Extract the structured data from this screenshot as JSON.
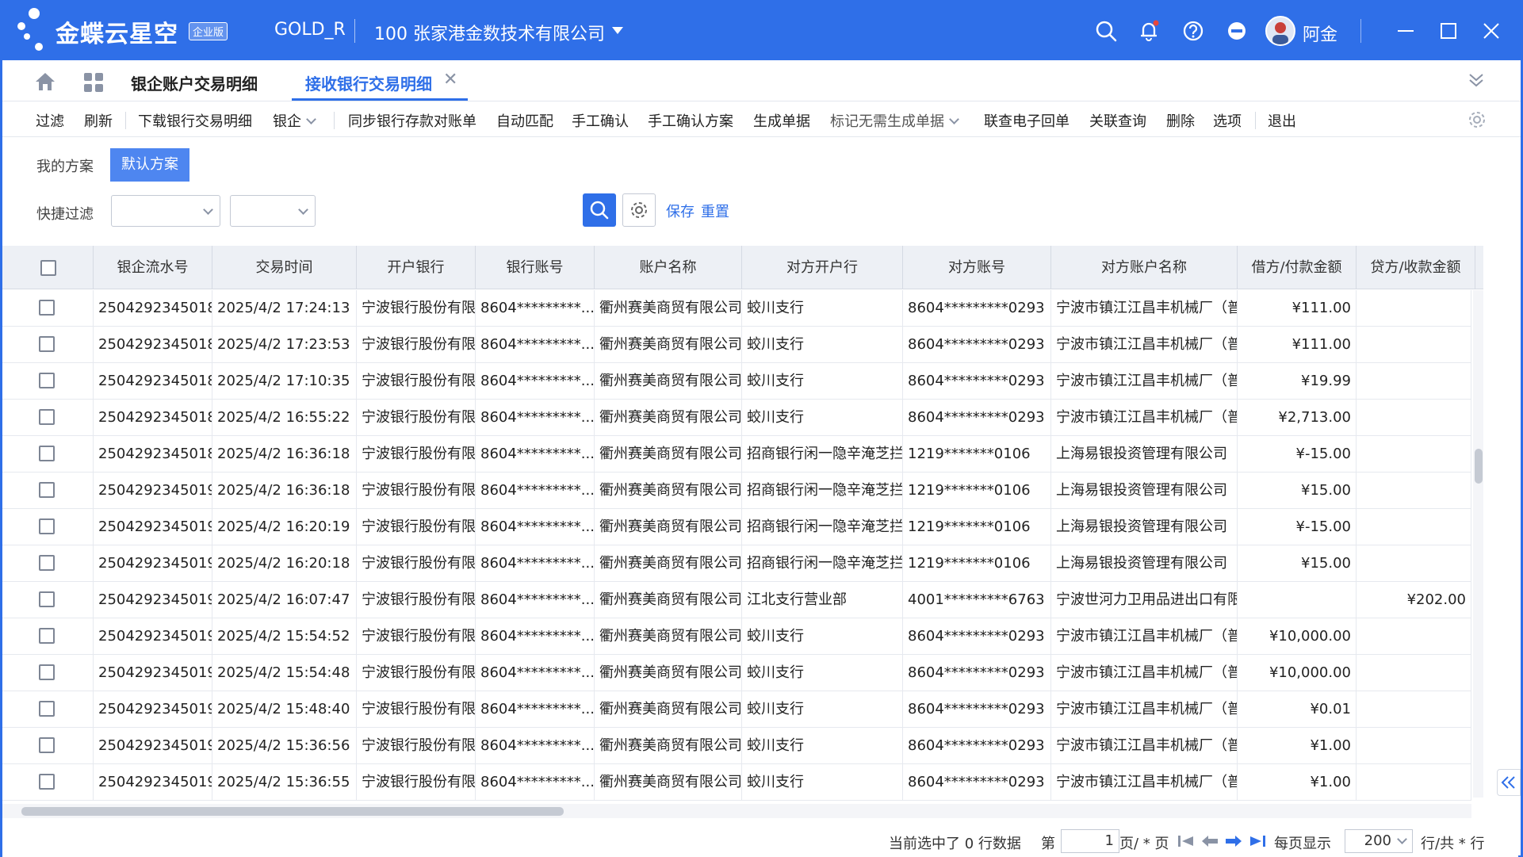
{
  "app": {
    "brand": "金蝶云星空",
    "edition": "企业版",
    "tenant": "GOLD_R",
    "org": "100  张家港金数技术有限公司",
    "user": "阿金"
  },
  "tabs": [
    {
      "label": "银企账户交易明细"
    },
    {
      "label": "接收银行交易明细"
    }
  ],
  "toolbar": {
    "filter": "过滤",
    "refresh": "刷新",
    "download": "下载银行交易明细",
    "yinqi": "银企",
    "sync": "同步银行存款对账单",
    "auto_match": "自动匹配",
    "manual_confirm": "手工确认",
    "manual_plan": "手工确认方案",
    "gen_doc": "生成单据",
    "mark_no_doc": "标记无需生成单据",
    "e_receipt": "联查电子回单",
    "rel_query": "关联查询",
    "delete": "删除",
    "options": "选项",
    "exit": "退出"
  },
  "filter": {
    "my_scheme": "我的方案",
    "default_scheme": "默认方案",
    "quick_filter": "快捷过滤",
    "save": "保存",
    "reset": "重置"
  },
  "grid": {
    "columns": [
      "银企流水号",
      "交易时间",
      "开户银行",
      "银行账号",
      "账户名称",
      "对方开户行",
      "对方账号",
      "对方账户名称",
      "借方/付款金额",
      "贷方/收款金额"
    ],
    "rows": [
      [
        "2504292345018",
        "2025/4/2 17:24:13",
        "宁波银行股份有限",
        "8604*********...",
        "衢州赛美商贸有限公司",
        "蛟川支行",
        "8604*********0293",
        "宁波市镇江江昌丰机械厂（普",
        "¥111.00",
        ""
      ],
      [
        "2504292345018",
        "2025/4/2 17:23:53",
        "宁波银行股份有限",
        "8604*********...",
        "衢州赛美商贸有限公司",
        "蛟川支行",
        "8604*********0293",
        "宁波市镇江江昌丰机械厂（普",
        "¥111.00",
        ""
      ],
      [
        "2504292345018",
        "2025/4/2 17:10:35",
        "宁波银行股份有限",
        "8604*********...",
        "衢州赛美商贸有限公司",
        "蛟川支行",
        "8604*********0293",
        "宁波市镇江江昌丰机械厂（普",
        "¥19.99",
        ""
      ],
      [
        "2504292345018",
        "2025/4/2 16:55:22",
        "宁波银行股份有限",
        "8604*********...",
        "衢州赛美商贸有限公司",
        "蛟川支行",
        "8604*********0293",
        "宁波市镇江江昌丰机械厂（普",
        "¥2,713.00",
        ""
      ],
      [
        "2504292345018",
        "2025/4/2 16:36:18",
        "宁波银行股份有限",
        "8604*********...",
        "衢州赛美商贸有限公司",
        "招商银行闲一隐辛淹芝拦",
        "1219*******0106",
        "上海易银投资管理有限公司",
        "¥-15.00",
        ""
      ],
      [
        "2504292345019",
        "2025/4/2 16:36:18",
        "宁波银行股份有限",
        "8604*********...",
        "衢州赛美商贸有限公司",
        "招商银行闲一隐辛淹芝拦",
        "1219*******0106",
        "上海易银投资管理有限公司",
        "¥15.00",
        ""
      ],
      [
        "2504292345019",
        "2025/4/2 16:20:19",
        "宁波银行股份有限",
        "8604*********...",
        "衢州赛美商贸有限公司",
        "招商银行闲一隐辛淹芝拦",
        "1219*******0106",
        "上海易银投资管理有限公司",
        "¥-15.00",
        ""
      ],
      [
        "2504292345019",
        "2025/4/2 16:20:18",
        "宁波银行股份有限",
        "8604*********...",
        "衢州赛美商贸有限公司",
        "招商银行闲一隐辛淹芝拦",
        "1219*******0106",
        "上海易银投资管理有限公司",
        "¥15.00",
        ""
      ],
      [
        "2504292345019",
        "2025/4/2 16:07:47",
        "宁波银行股份有限",
        "8604*********...",
        "衢州赛美商贸有限公司",
        "江北支行营业部",
        "4001*********6763",
        "宁波世河力卫用品进出口有限",
        "",
        "¥202.00"
      ],
      [
        "2504292345019",
        "2025/4/2 15:54:52",
        "宁波银行股份有限",
        "8604*********...",
        "衢州赛美商贸有限公司",
        "蛟川支行",
        "8604*********0293",
        "宁波市镇江江昌丰机械厂（普",
        "¥10,000.00",
        ""
      ],
      [
        "2504292345019",
        "2025/4/2 15:54:48",
        "宁波银行股份有限",
        "8604*********...",
        "衢州赛美商贸有限公司",
        "蛟川支行",
        "8604*********0293",
        "宁波市镇江江昌丰机械厂（普",
        "¥10,000.00",
        ""
      ],
      [
        "2504292345019",
        "2025/4/2 15:48:40",
        "宁波银行股份有限",
        "8604*********...",
        "衢州赛美商贸有限公司",
        "蛟川支行",
        "8604*********0293",
        "宁波市镇江江昌丰机械厂（普",
        "¥0.01",
        ""
      ],
      [
        "2504292345019",
        "2025/4/2 15:36:56",
        "宁波银行股份有限",
        "8604*********...",
        "衢州赛美商贸有限公司",
        "蛟川支行",
        "8604*********0293",
        "宁波市镇江江昌丰机械厂（普",
        "¥1.00",
        ""
      ],
      [
        "2504292345019",
        "2025/4/2 15:36:55",
        "宁波银行股份有限",
        "8604*********...",
        "衢州赛美商贸有限公司",
        "蛟川支行",
        "8604*********0293",
        "宁波市镇江江昌丰机械厂（普",
        "¥1.00",
        ""
      ]
    ]
  },
  "pager": {
    "selected_info": "当前选中了 0 行数据",
    "page_prefix": "第",
    "page_value": "1",
    "page_suffix": "页/ * 页",
    "per_page_label": "每页显示",
    "per_page_value": "200",
    "total_suffix": "行/共 * 行"
  },
  "icons": {
    "home": "home-icon",
    "apps": "grid-icon",
    "search": "search-icon",
    "bell": "bell-icon",
    "help": "help-icon",
    "minus_circle": "minus-circle-icon",
    "settings": "gear-icon"
  },
  "colors": {
    "accent": "#2f6fe8",
    "notification_dot": "#e8473c"
  }
}
